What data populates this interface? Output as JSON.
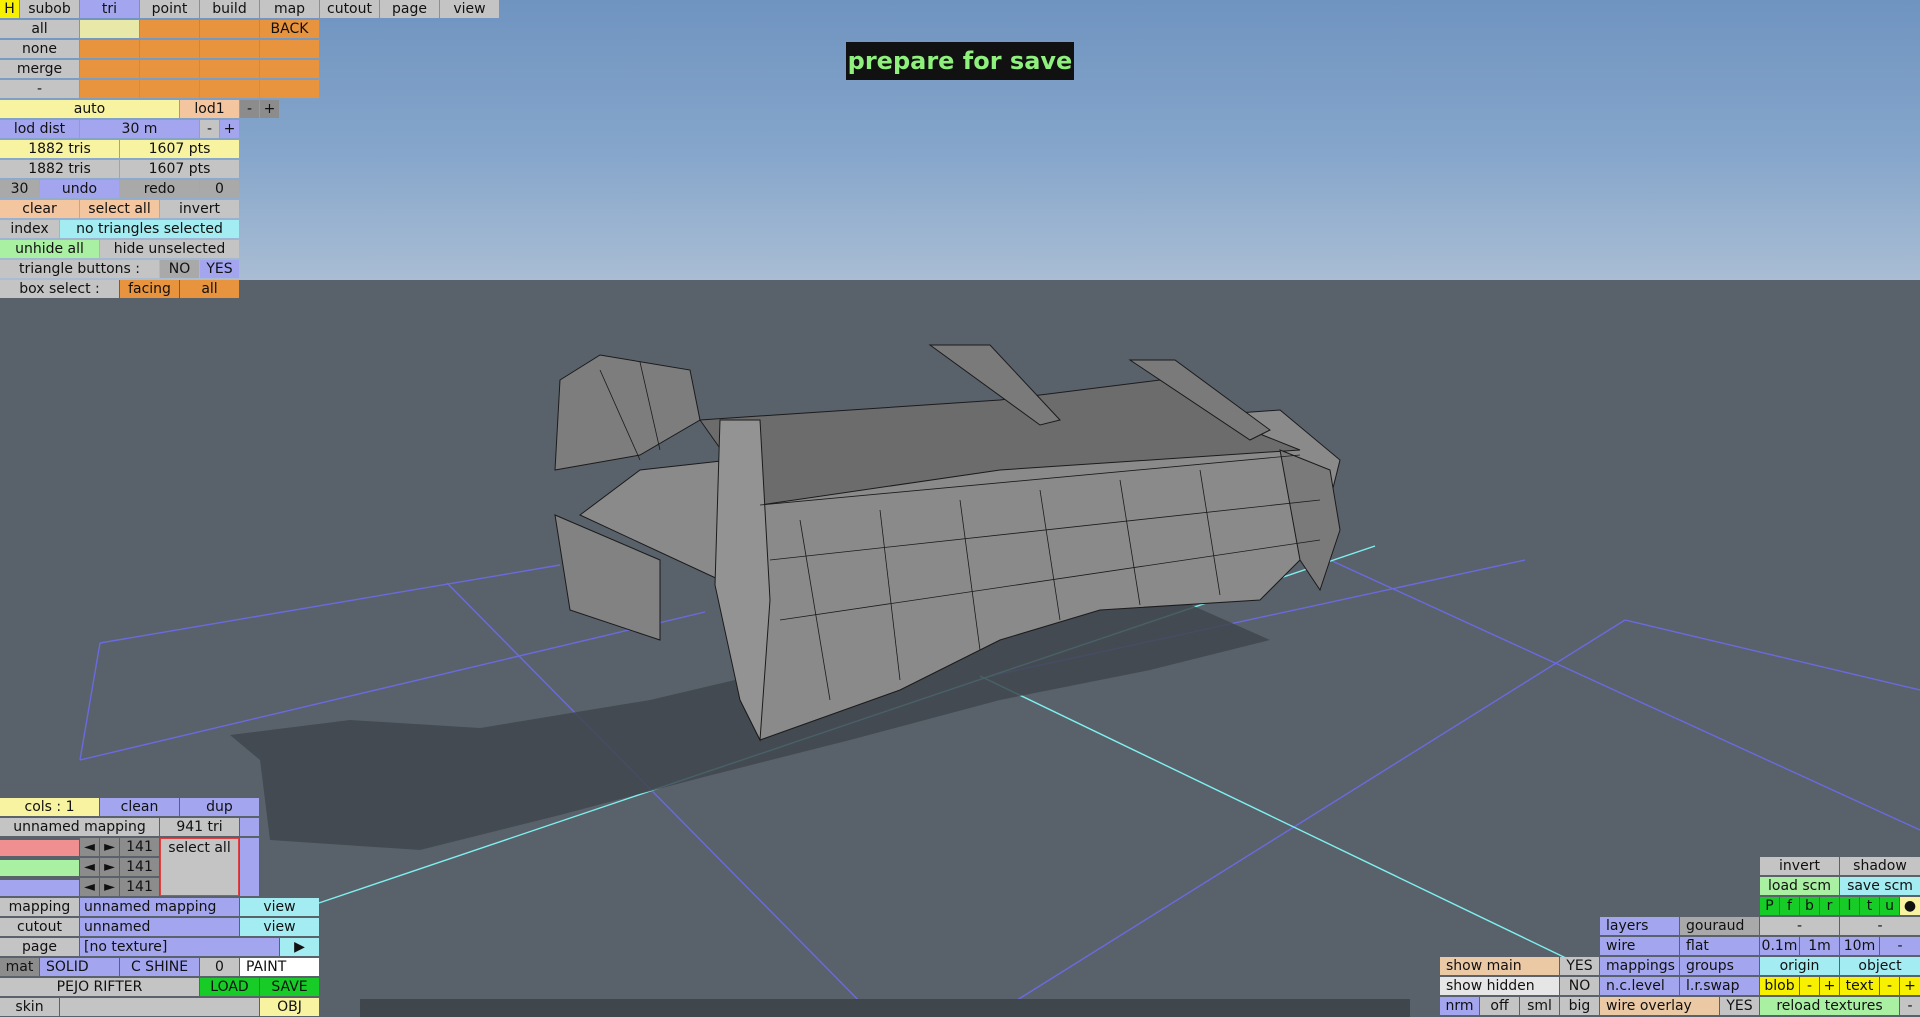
{
  "banner": "prepare for save",
  "top_menu": {
    "h": "H",
    "items": [
      "subob",
      "tri",
      "point",
      "build",
      "map",
      "cutout",
      "page",
      "view"
    ]
  },
  "select_col": [
    "all",
    "none",
    "merge",
    "-"
  ],
  "back": "BACK",
  "lod": {
    "auto": "auto",
    "name": "lod1",
    "minus": "-",
    "plus": "+",
    "dist_label": "lod dist",
    "dist_value": "30 m"
  },
  "stats": {
    "tris1": "1882 tris",
    "pts1": "1607 pts",
    "tris2": "1882 tris",
    "pts2": "1607 pts"
  },
  "undo_row": {
    "count": "30",
    "undo": "undo",
    "redo": "redo",
    "redo_count": "0"
  },
  "sel_row": {
    "clear": "clear",
    "select_all": "select all",
    "invert": "invert"
  },
  "index_row": {
    "index": "index",
    "status": "no triangles selected"
  },
  "hide_row": {
    "unhide": "unhide all",
    "hide": "hide unselected"
  },
  "tri_buttons": {
    "label": "triangle buttons :",
    "no": "NO",
    "yes": "YES"
  },
  "box_select": {
    "label": "box select :",
    "facing": "facing",
    "all": "all"
  },
  "cols_panel": {
    "cols": "cols : 1",
    "clean": "clean",
    "dup": "dup",
    "mapping_name": "unnamed mapping",
    "tri_count": "941 tri",
    "r": "141",
    "g": "141",
    "b": "141",
    "select_all": "select all",
    "arrow_l": "◄",
    "arrow_r": "►"
  },
  "mapping_row": {
    "label": "mapping",
    "value": "unnamed mapping",
    "view": "view"
  },
  "cutout_row": {
    "label": "cutout",
    "value": "unnamed",
    "view": "view"
  },
  "page_row": {
    "label": "page",
    "value": "[no texture]",
    "arrow": "▶"
  },
  "mat_row": {
    "mat": "mat",
    "solid": "SOLID",
    "shine": "C SHINE",
    "num": "0",
    "paint": "PAINT"
  },
  "file_row": {
    "name": "PEJO RIFTER",
    "load": "LOAD",
    "save": "SAVE"
  },
  "skin_row": {
    "skin": "skin",
    "obj": "OBJ"
  },
  "right_panel": {
    "invert": "invert",
    "shadow": "shadow",
    "load_scm": "load scm",
    "save_scm": "save scm",
    "letters": [
      "P",
      "f",
      "b",
      "r",
      "l",
      "t",
      "u"
    ],
    "dot": "●",
    "layers": "layers",
    "gouraud": "gouraud",
    "dash1": "-",
    "dash2": "-",
    "wire": "wire",
    "flat": "flat",
    "s1": "0.1m",
    "s2": "1m",
    "s3": "10m",
    "s4": "-",
    "mappings": "mappings",
    "groups": "groups",
    "origin": "origin",
    "object": "object",
    "nclevel": "n.c.level",
    "lrswap": "l.r.swap",
    "blob": "blob",
    "bm": "-",
    "bp": "+",
    "text": "text",
    "tm": "-",
    "tp": "+",
    "nrm": "nrm",
    "off": "off",
    "sml": "sml",
    "big": "big",
    "wire_overlay": "wire overlay",
    "wo_yes": "YES",
    "reload": "reload textures",
    "rl_minus": "-"
  },
  "show_panel": {
    "show_main": "show main",
    "show_main_v": "YES",
    "show_hidden": "show hidden",
    "show_hidden_v": "NO"
  }
}
